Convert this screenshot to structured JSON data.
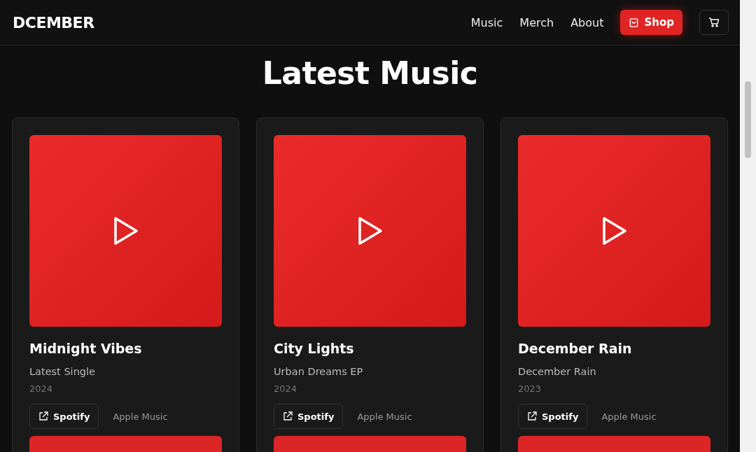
{
  "header": {
    "logo": "DCEMBER",
    "nav": [
      "Music",
      "Merch",
      "About"
    ],
    "shop_button": "Shop"
  },
  "heading": "Latest Music",
  "releases": [
    {
      "title": "Midnight Vibes",
      "subtitle": "Latest Single",
      "year": "2024",
      "links": [
        "Spotify",
        "Apple Music"
      ]
    },
    {
      "title": "City Lights",
      "subtitle": "Urban Dreams EP",
      "year": "2024",
      "links": [
        "Spotify",
        "Apple Music"
      ]
    },
    {
      "title": "December Rain",
      "subtitle": "December Rain",
      "year": "2023",
      "links": [
        "Spotify",
        "Apple Music"
      ]
    }
  ]
}
